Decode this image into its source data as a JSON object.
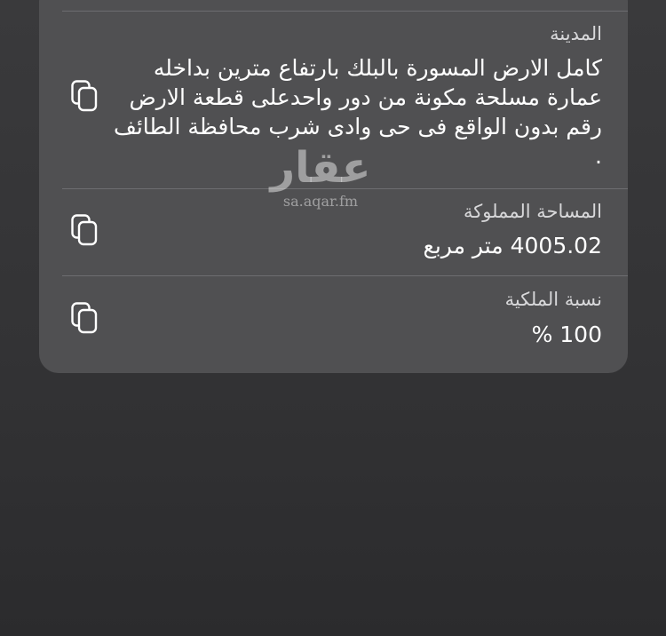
{
  "watermark": {
    "logo": "عقار",
    "url": "sa.aqar.fm"
  },
  "fields": [
    {
      "label": "المدينة",
      "value": "كامل الارض المسورة بالبلك بارتفاع مترين بداخله عمارة مسلحة مكونة من دور واحدعلى قطعة الارض رقم بدون الواقع فى حى وادى شرب محافظة الطائف .",
      "copy_icon": "copy-icon"
    },
    {
      "label": "المساحة المملوكة",
      "value": "4005.02 متر مربع",
      "copy_icon": "copy-icon"
    },
    {
      "label": "نسبة الملكية",
      "value": "100 %",
      "copy_icon": "copy-icon"
    }
  ]
}
